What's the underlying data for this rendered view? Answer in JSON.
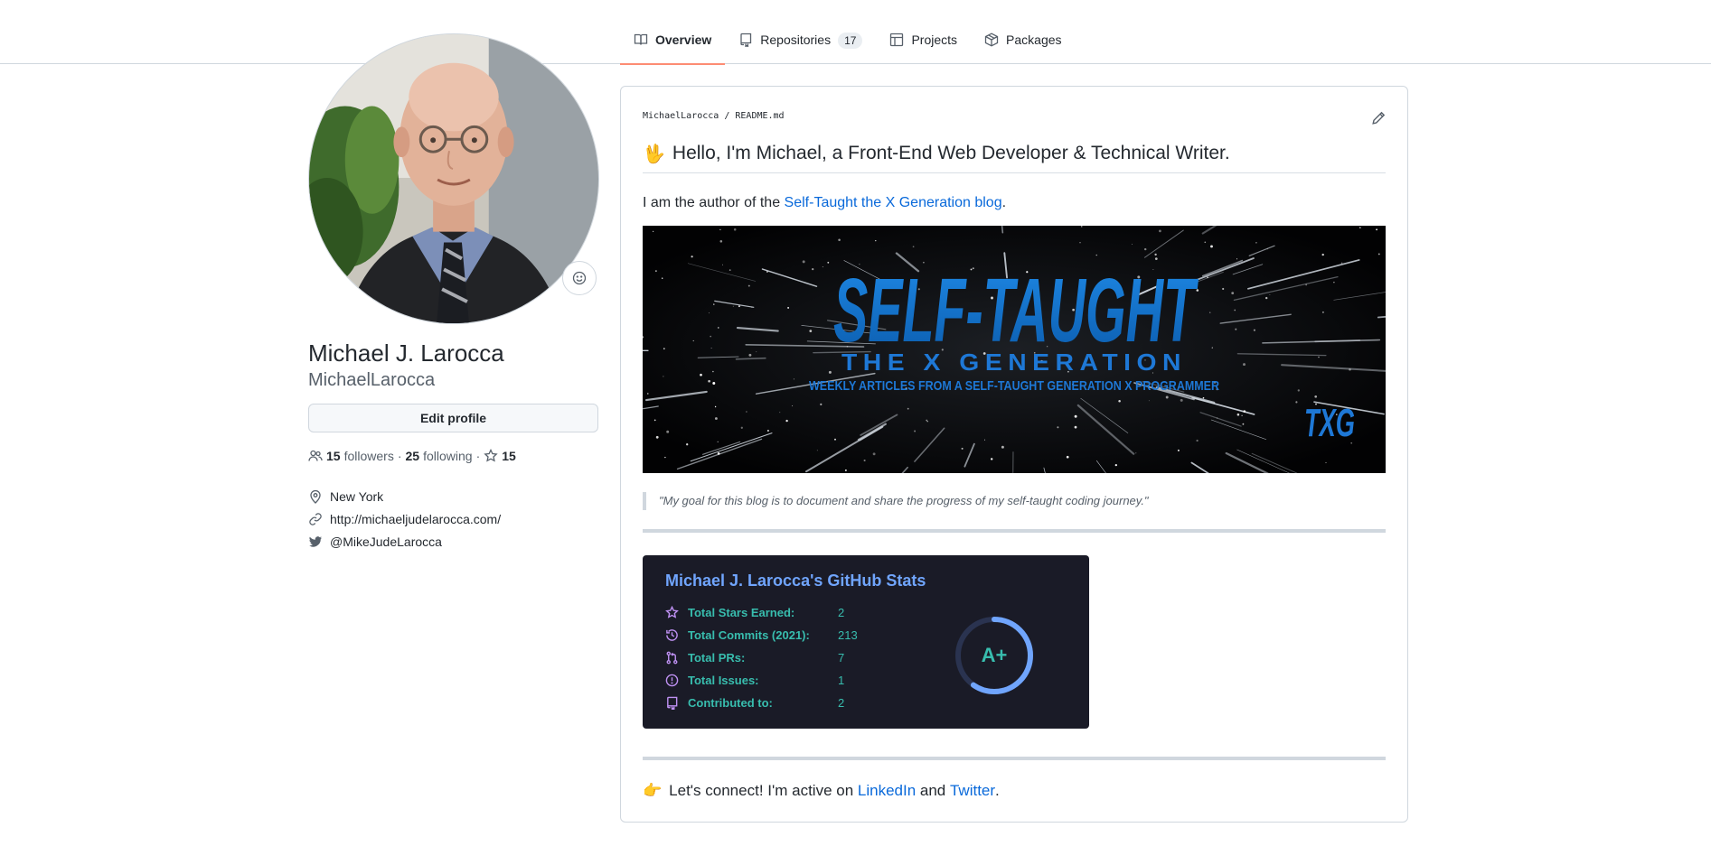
{
  "tabs": [
    {
      "label": "Overview",
      "icon": "book-icon",
      "active": true
    },
    {
      "label": "Repositories",
      "icon": "repo-icon",
      "count": "17"
    },
    {
      "label": "Projects",
      "icon": "table-icon"
    },
    {
      "label": "Packages",
      "icon": "package-icon"
    }
  ],
  "profile": {
    "full_name": "Michael J. Larocca",
    "username": "MichaelLarocca",
    "edit_label": "Edit profile",
    "followers_count": "15",
    "followers_label": "followers",
    "following_count": "25",
    "following_label": "following",
    "stars_count": "15",
    "separator": "·",
    "location": "New York",
    "website": "http://michaeljudelarocca.com/",
    "twitter": "@MikeJudeLarocca"
  },
  "readme": {
    "path_user": "MichaelLarocca",
    "path_sep": "/",
    "path_file": "README.md",
    "heading_emoji": "🖖",
    "heading": "Hello, I'm Michael, a Front-End Web Developer & Technical Writer.",
    "intro_prefix": "I am the author of the ",
    "intro_link": "Self-Taught the X Generation blog",
    "intro_suffix": ".",
    "banner": {
      "title": "SELF-TAUGHT",
      "subtitle": "THE X GENERATION",
      "tagline": "WEEKLY ARTICLES FROM A SELF-TAUGHT GENERATION X PROGRAMMER",
      "logo": "TXG"
    },
    "quote": "\"My goal for this blog is to document and share the progress of my self-taught coding journey.\"",
    "stats": {
      "title": "Michael J. Larocca's GitHub Stats",
      "rows": [
        {
          "icon": "star-icon",
          "label": "Total Stars Earned:",
          "value": "2"
        },
        {
          "icon": "history-icon",
          "label": "Total Commits (2021):",
          "value": "213"
        },
        {
          "icon": "pull-request-icon",
          "label": "Total PRs:",
          "value": "7"
        },
        {
          "icon": "issue-icon",
          "label": "Total Issues:",
          "value": "1"
        },
        {
          "icon": "repo-icon",
          "label": "Contributed to:",
          "value": "2"
        }
      ],
      "rank": "A+",
      "colors": {
        "bg": "#1a1b27",
        "title": "#70a5fd",
        "text": "#38bdae",
        "icon": "#bf91f3"
      }
    },
    "connect_emoji": "👉",
    "connect_prefix": "Let's connect! I'm active on ",
    "connect_link1": "LinkedIn",
    "connect_mid": " and ",
    "connect_link2": "Twitter",
    "connect_suffix": "."
  },
  "colors": {
    "link": "#0969da",
    "tab_underline": "#fd8c73"
  }
}
